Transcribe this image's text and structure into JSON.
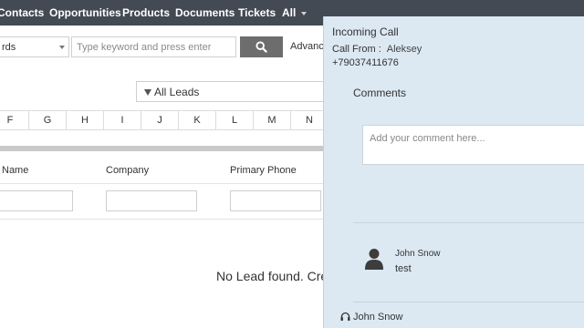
{
  "nav": {
    "items": [
      "Contacts",
      "Opportunities",
      "Products",
      "Documents",
      "Tickets",
      "All"
    ]
  },
  "search": {
    "select_value": "rds",
    "placeholder": "Type keyword and press enter",
    "advanced_label": "Advance"
  },
  "filter": {
    "selected": "All Leads"
  },
  "alphabet": [
    "F",
    "G",
    "H",
    "I",
    "J",
    "K",
    "L",
    "M",
    "N"
  ],
  "columns": [
    "Name",
    "Company",
    "Primary Phone"
  ],
  "empty_message": "No Lead found. Cre",
  "call": {
    "title": "Incoming Call",
    "from_label": "Call From :",
    "caller_name": "Aleksey",
    "phone": "+79037411676",
    "comments_title": "Comments",
    "comment_placeholder": "Add your comment here...",
    "comments": [
      {
        "author": "John Snow",
        "text": "test"
      }
    ],
    "agent": "John Snow"
  },
  "colors": {
    "nav_bg": "#434a54",
    "panel_bg": "#dce9f3",
    "search_button": "#6d6d6d"
  }
}
